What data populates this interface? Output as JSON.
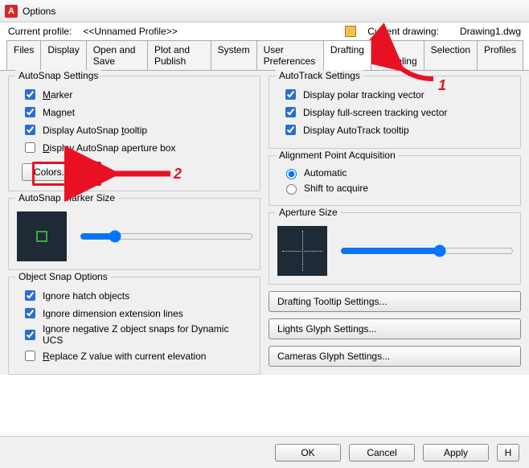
{
  "window": {
    "title": "Options"
  },
  "profile": {
    "label": "Current profile:",
    "value": "<<Unnamed Profile>>"
  },
  "drawing": {
    "label": "Current drawing:",
    "value": "Drawing1.dwg"
  },
  "tabs": [
    "Files",
    "Display",
    "Open and Save",
    "Plot and Publish",
    "System",
    "User Preferences",
    "Drafting",
    "3D Modeling",
    "Selection",
    "Profiles"
  ],
  "active_tab": "Drafting",
  "autosnap": {
    "legend": "AutoSnap Settings",
    "marker": "Marker",
    "magnet": "Magnet",
    "tooltip": "Display AutoSnap tooltip",
    "aperture": "Display AutoSnap aperture box",
    "colors_btn": "Colors..."
  },
  "marker_size": {
    "legend": "AutoSnap Marker Size"
  },
  "osnap": {
    "legend": "Object Snap Options",
    "hatch": "Ignore hatch objects",
    "dimext": "Ignore dimension extension lines",
    "negz": "Ignore negative Z object snaps for Dynamic UCS",
    "replacez": "Replace Z value with current elevation"
  },
  "autotrack": {
    "legend": "AutoTrack Settings",
    "polar": "Display polar tracking vector",
    "fullscreen": "Display full-screen tracking vector",
    "tooltip": "Display AutoTrack tooltip"
  },
  "alignment": {
    "legend": "Alignment Point Acquisition",
    "auto": "Automatic",
    "shift": "Shift to acquire"
  },
  "aperture": {
    "legend": "Aperture Size"
  },
  "rightbtns": {
    "tooltip": "Drafting Tooltip Settings...",
    "lights": "Lights Glyph Settings...",
    "cameras": "Cameras Glyph Settings..."
  },
  "bottom": {
    "ok": "OK",
    "cancel": "Cancel",
    "apply": "Apply"
  },
  "anno": {
    "n1": "1",
    "n2": "2"
  }
}
